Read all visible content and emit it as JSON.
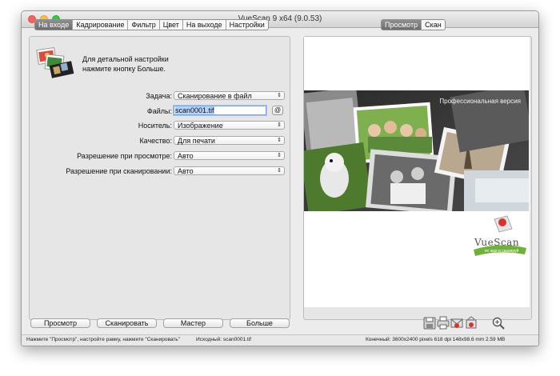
{
  "window": {
    "title": "VueScan 9 x64 (9.0.53)"
  },
  "left_tabs": [
    {
      "label": "На входе",
      "active": true
    },
    {
      "label": "Кадрирование",
      "active": false
    },
    {
      "label": "Фильтр",
      "active": false
    },
    {
      "label": "Цвет",
      "active": false
    },
    {
      "label": "На выходе",
      "active": false
    },
    {
      "label": "Настройки",
      "active": false
    }
  ],
  "right_tabs": [
    {
      "label": "Просмотр",
      "active": true
    },
    {
      "label": "Скан",
      "active": false
    }
  ],
  "info": {
    "line1": "Для детальной настройки",
    "line2": "нажмите кнопку Больше."
  },
  "form": {
    "task": {
      "label": "Задача:",
      "value": "Сканирование в файл"
    },
    "files": {
      "label": "Файлы:",
      "value": "scan0001.tif",
      "button": "@"
    },
    "media": {
      "label": "Носитель:",
      "value": "Изображение"
    },
    "quality": {
      "label": "Качество:",
      "value": "Для печати"
    },
    "preview_res": {
      "label": "Разрешение при просмотре:",
      "value": "Авто"
    },
    "scan_res": {
      "label": "Разрешение при сканировании:",
      "value": "Авто"
    }
  },
  "preview": {
    "caption": "Профессиональная версия",
    "logo": "VueScan",
    "logo_tag": "не жди и сканируй"
  },
  "buttons": {
    "preview": "Просмотр",
    "scan": "Сканировать",
    "wizard": "Мастер",
    "more": "Больше"
  },
  "toolbar_icons": [
    "save-icon",
    "print-icon",
    "email-icon",
    "share-icon",
    "zoom-icon"
  ],
  "status": {
    "left": "Нажмите \"Просмотр\", настройте рамку, нажмите \"Сканировать\"",
    "middle": "Исходный: scan0001.tif",
    "right": "Конечный: 3600x2400 pixels 618 dpi 148x98.6 mm 2.59 MB"
  },
  "colors": {
    "active_tab": "#7a7a7a",
    "focus_ring": "#7aa7e0",
    "logo_green": "#6fb23a",
    "logo_red": "#d9332b"
  }
}
